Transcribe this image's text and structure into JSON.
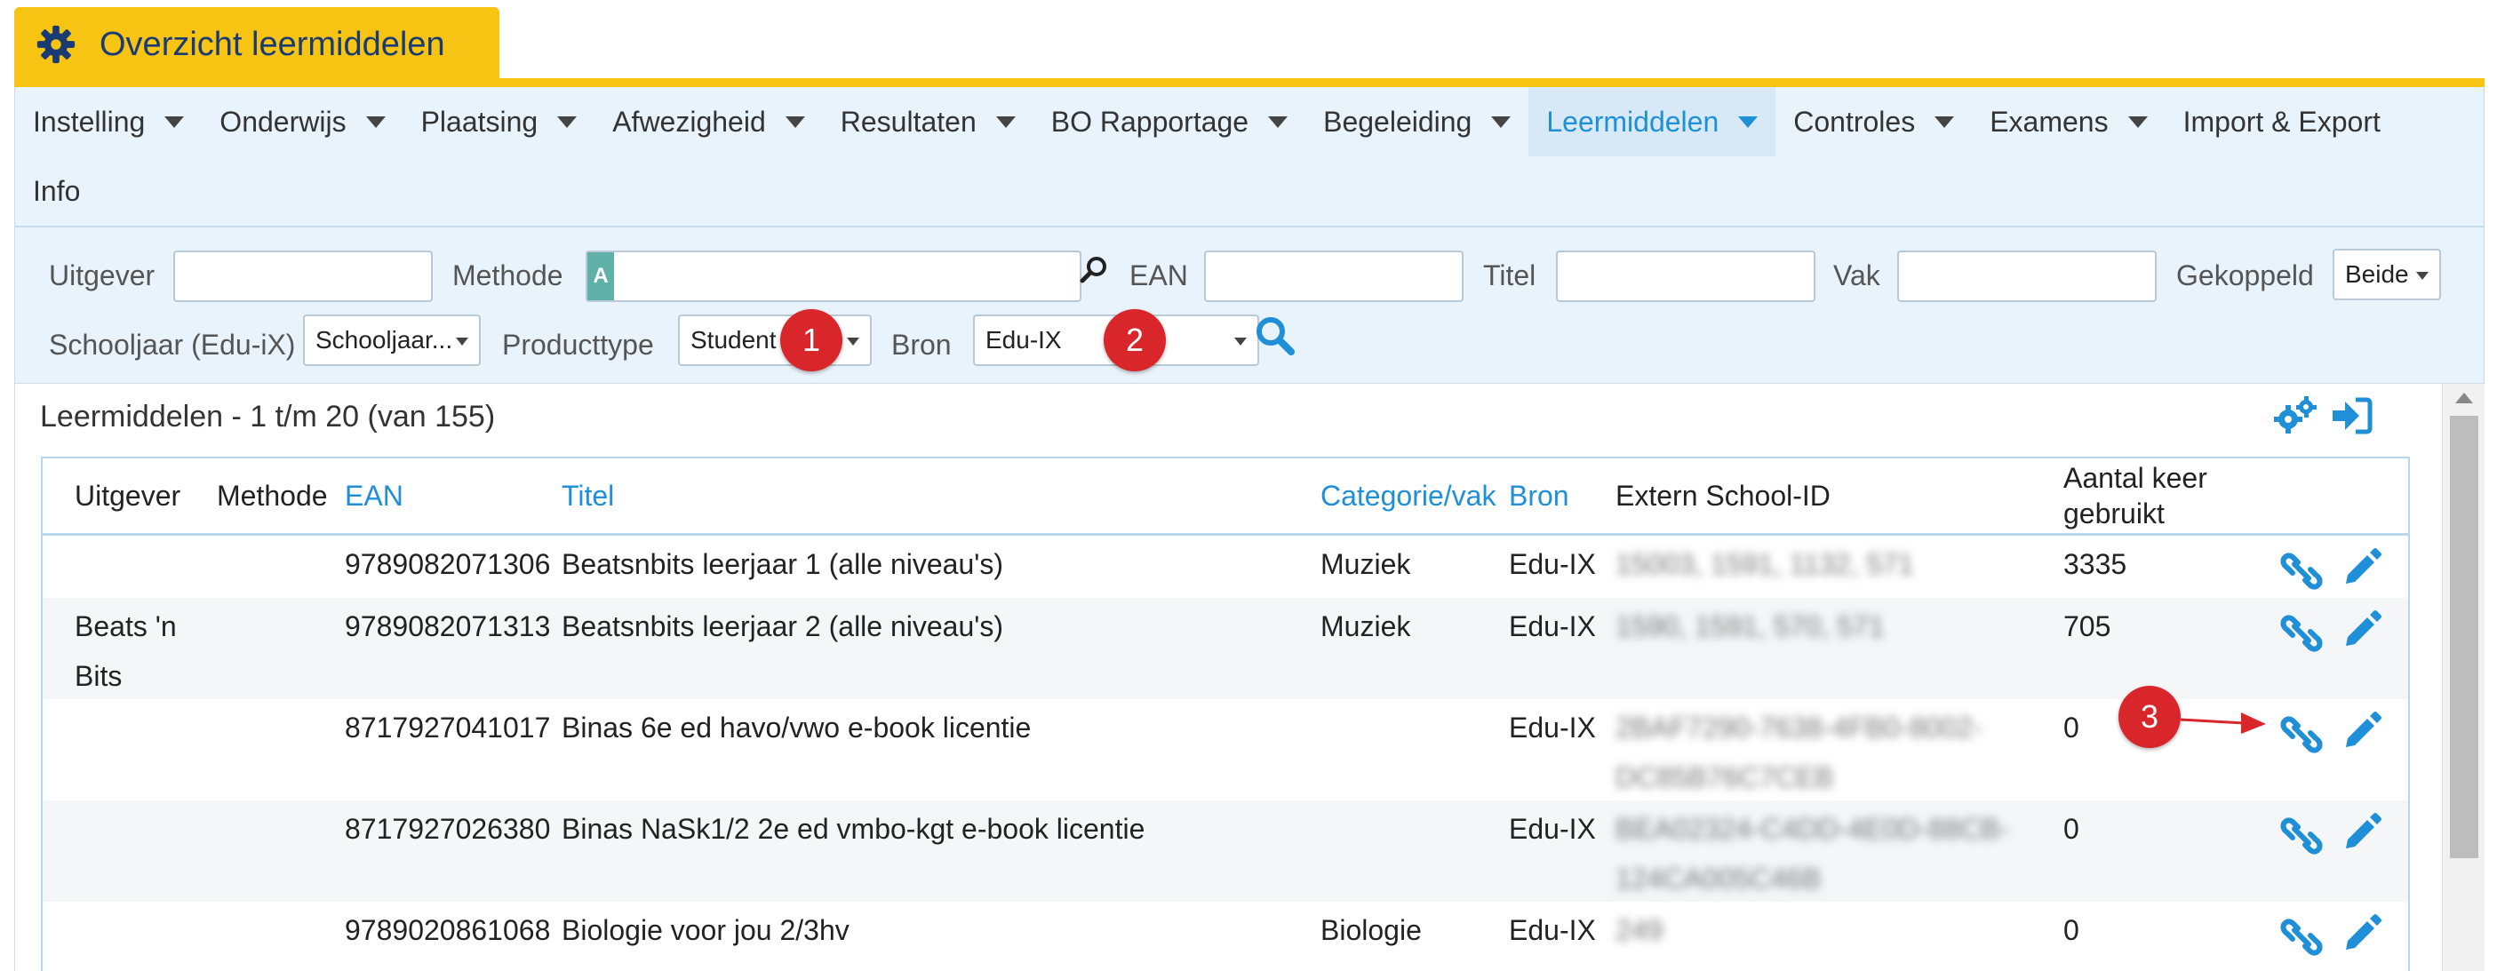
{
  "title": "Overzicht leermiddelen",
  "nav": {
    "row1": [
      {
        "label": "Instelling",
        "active": false
      },
      {
        "label": "Onderwijs",
        "active": false
      },
      {
        "label": "Plaatsing",
        "active": false
      },
      {
        "label": "Afwezigheid",
        "active": false
      },
      {
        "label": "Resultaten",
        "active": false
      },
      {
        "label": "BO Rapportage",
        "active": false
      },
      {
        "label": "Begeleiding",
        "active": false
      },
      {
        "label": "Leermiddelen",
        "active": true
      },
      {
        "label": "Controles",
        "active": false
      },
      {
        "label": "Examens",
        "active": false
      },
      {
        "label": "Import & Export",
        "active": false
      }
    ],
    "row2": [
      {
        "label": "Info",
        "active": false
      }
    ]
  },
  "filters": {
    "uitgever_label": "Uitgever",
    "uitgever_value": "",
    "methode_label": "Methode",
    "methode_value": "",
    "ean_label": "EAN",
    "ean_value": "",
    "titel_label": "Titel",
    "titel_value": "",
    "vak_label": "Vak",
    "vak_value": "",
    "gekoppeld_label": "Gekoppeld",
    "gekoppeld_value": "Beide",
    "schooljaar_label": "Schooljaar (Edu-iX)",
    "schooljaar_value": "Schooljaar...",
    "producttype_label": "Producttype",
    "producttype_value": "Student",
    "bron_label": "Bron",
    "bron_value": "Edu-IX"
  },
  "annotations": [
    "1",
    "2",
    "3"
  ],
  "list": {
    "title": "Leermiddelen - 1 t/m 20 (van 155)",
    "columns": {
      "uitgever": "Uitgever",
      "methode": "Methode",
      "ean": "EAN",
      "titel": "Titel",
      "categorie": "Categorie/vak",
      "bron": "Bron",
      "extern": "Extern School-ID",
      "aantal_line1": "Aantal keer",
      "aantal_line2": "gebruikt"
    },
    "rows": [
      {
        "uitgever_l1": "",
        "uitgever_l2": "",
        "ean": "9789082071306",
        "titel": "Beatsnbits leerjaar 1 (alle niveau's)",
        "categorie": "Muziek",
        "bron": "Edu-IX",
        "extern_l1": "15003, 1591, 1132, 571",
        "extern_l2": "",
        "aantal": "3335"
      },
      {
        "uitgever_l1": "Beats 'n",
        "uitgever_l2": "Bits",
        "ean": "9789082071313",
        "titel": "Beatsnbits leerjaar 2 (alle niveau's)",
        "categorie": "Muziek",
        "bron": "Edu-IX",
        "extern_l1": "1590, 1591, 570, 571",
        "extern_l2": "",
        "aantal": "705"
      },
      {
        "uitgever_l1": "",
        "uitgever_l2": "",
        "ean": "8717927041017",
        "titel": "Binas 6e ed havo/vwo e-book licentie",
        "categorie": "",
        "bron": "Edu-IX",
        "extern_l1": "2BAF7290-7638-4FB0-8002-",
        "extern_l2": "DC85B76C7CEB",
        "aantal": "0"
      },
      {
        "uitgever_l1": "",
        "uitgever_l2": "",
        "ean": "8717927026380",
        "titel": "Binas NaSk1/2 2e ed vmbo-kgt e-book licentie",
        "categorie": "",
        "bron": "Edu-IX",
        "extern_l1": "BEA02324-C4DD-4E0D-88CB-",
        "extern_l2": "124CA005C46B",
        "aantal": "0"
      },
      {
        "uitgever_l1": "",
        "uitgever_l2": "",
        "ean": "9789020861068",
        "titel": "Biologie voor jou 2/3hv",
        "categorie": "Biologie",
        "bron": "Edu-IX",
        "extern_l1": "249",
        "extern_l2": "",
        "aantal": "0"
      }
    ]
  },
  "colors": {
    "accent_gold": "#f7c414",
    "title_text": "#1a3a73",
    "link_blue": "#1f8fd8",
    "annotation_red": "#d9262b"
  }
}
